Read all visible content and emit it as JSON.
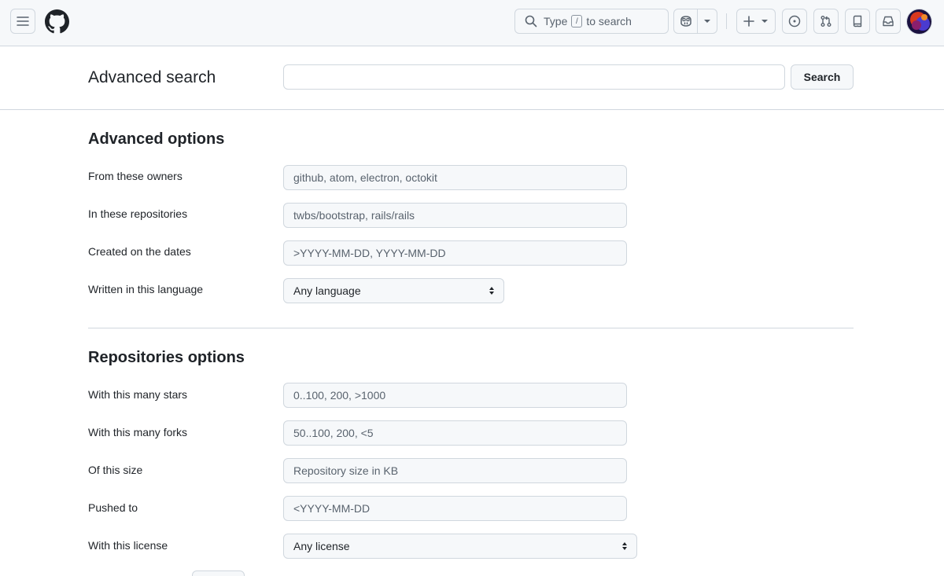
{
  "header": {
    "search_prefix": "Type",
    "search_key": "/",
    "search_suffix": "to search"
  },
  "search": {
    "title": "Advanced search",
    "query_value": "",
    "button_label": "Search"
  },
  "advanced_options": {
    "title": "Advanced options",
    "fields": [
      {
        "label": "From these owners",
        "placeholder": "github, atom, electron, octokit"
      },
      {
        "label": "In these repositories",
        "placeholder": "twbs/bootstrap, rails/rails"
      },
      {
        "label": "Created on the dates",
        "placeholder": ">YYYY-MM-DD, YYYY-MM-DD"
      },
      {
        "label": "Written in this language",
        "selected": "Any language"
      }
    ]
  },
  "repository_options": {
    "title": "Repositories options",
    "fields": [
      {
        "label": "With this many stars",
        "placeholder": "0..100, 200, >1000"
      },
      {
        "label": "With this many forks",
        "placeholder": "50..100, 200, <5"
      },
      {
        "label": "Of this size",
        "placeholder": "Repository size in KB"
      },
      {
        "label": "Pushed to",
        "placeholder": "<YYYY-MM-DD"
      },
      {
        "label": "With this license",
        "selected": "Any license"
      }
    ]
  },
  "icons": [
    "hamburger-menu-icon",
    "github-logo-icon",
    "search-icon",
    "copilot-icon",
    "caret-down-icon",
    "plus-icon",
    "issue-opened-icon",
    "git-pull-request-icon",
    "repo-icon",
    "inbox-icon",
    "avatar"
  ],
  "colors": {
    "header_bg": "#f6f8fa",
    "border": "#d0d7de",
    "text": "#1f2328",
    "muted": "#59636e"
  }
}
